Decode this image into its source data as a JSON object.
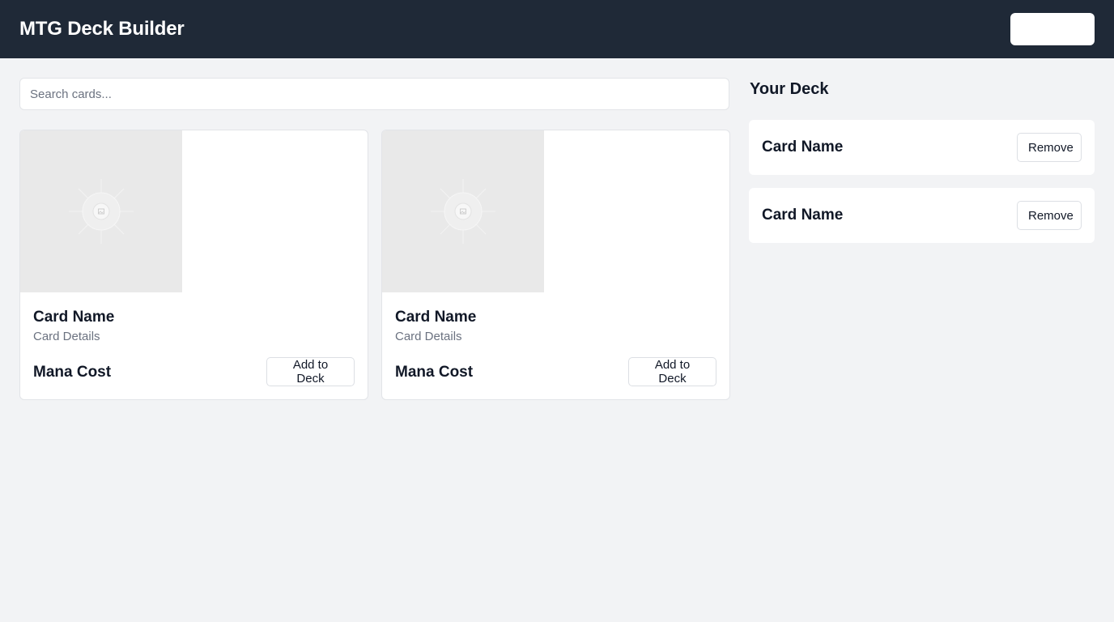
{
  "app": {
    "title": "MTG Deck Builder",
    "header_button_label": ""
  },
  "search": {
    "placeholder": "Search cards...",
    "value": ""
  },
  "cards": [
    {
      "image_icon": "image-placeholder-icon",
      "name": "Card Name",
      "details": "Card Details",
      "mana_cost": "Mana Cost",
      "add_label": "Add to Deck"
    },
    {
      "image_icon": "image-placeholder-icon",
      "name": "Card Name",
      "details": "Card Details",
      "mana_cost": "Mana Cost",
      "add_label": "Add to Deck"
    }
  ],
  "deck": {
    "heading": "Your Deck",
    "items": [
      {
        "name": "Card Name",
        "remove_label": "Remove"
      },
      {
        "name": "Card Name",
        "remove_label": "Remove"
      }
    ]
  },
  "colors": {
    "header_bg": "#1f2937",
    "page_bg": "#f2f3f5",
    "image_placeholder_bg": "#e9e9e9",
    "muted_text": "#6b7280"
  }
}
